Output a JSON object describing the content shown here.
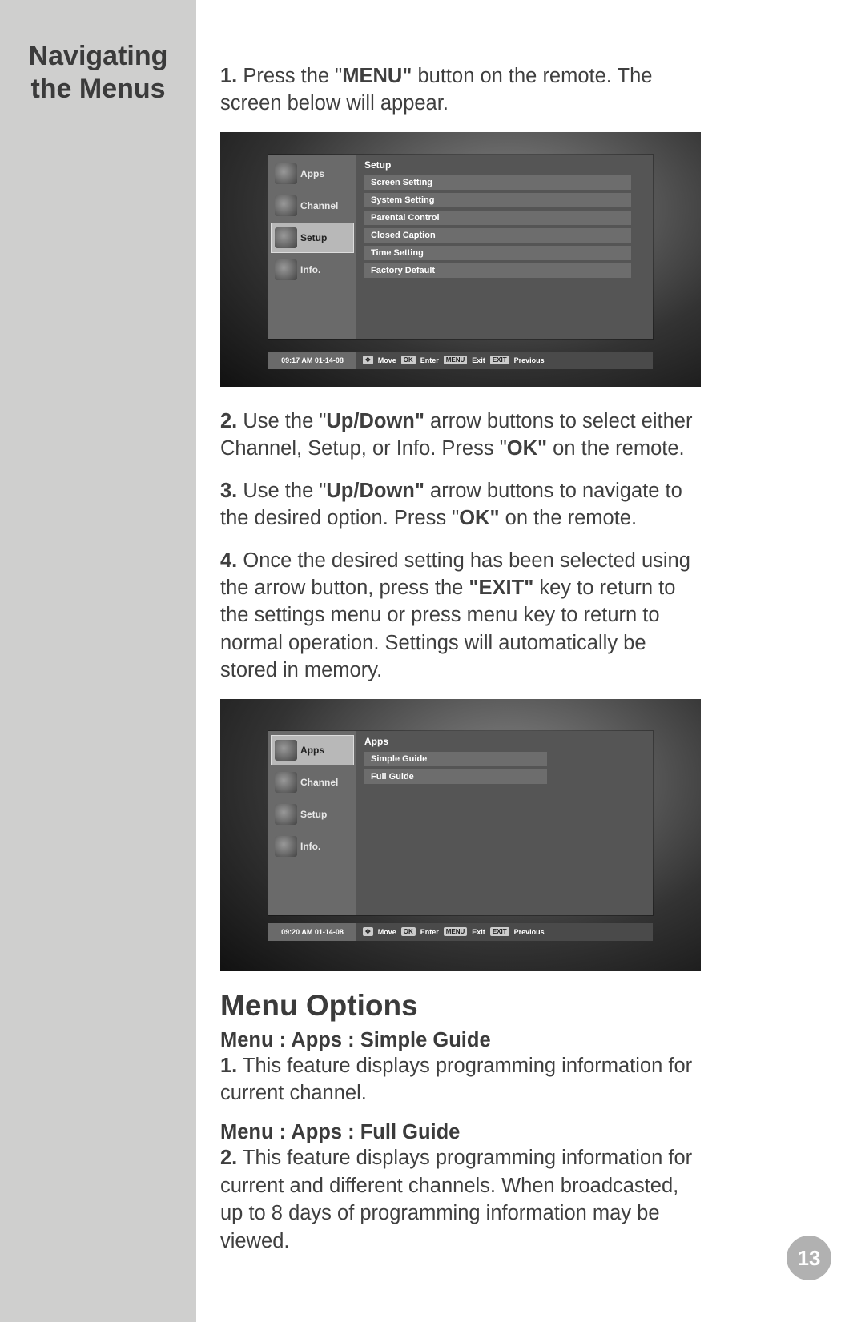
{
  "sidebar": {
    "title_line1": "Navigating",
    "title_line2": "the Menus"
  },
  "steps": {
    "s1_pre": "1.",
    "s1_a": " Press the \"",
    "s1_bold": "MENU\"",
    "s1_b": " button on the remote. The screen below will appear.",
    "s2_pre": "2.",
    "s2_a": " Use the \"",
    "s2_bold1": "Up/Down\"",
    "s2_b": " arrow buttons to select either Channel, Setup, or Info. Press \"",
    "s2_bold2": "OK\"",
    "s2_c": " on the remote.",
    "s3_pre": "3.",
    "s3_a": " Use the \"",
    "s3_bold1": "Up/Down\"",
    "s3_b": " arrow buttons to navigate to the desired option. Press \"",
    "s3_bold2": "OK\"",
    "s3_c": " on the remote.",
    "s4_pre": "4.",
    "s4_a": " Once the desired setting has been selected using the arrow button, press the ",
    "s4_bold": "\"EXIT\"",
    "s4_b": " key to return to the settings menu or press menu key to return to normal operation. Settings will automatically be stored in memory."
  },
  "shot1": {
    "tabs": [
      "Apps",
      "Channel",
      "Setup",
      "Info."
    ],
    "selected_index": 2,
    "panel_title": "Setup",
    "rows": [
      "Screen Setting",
      "System Setting",
      "Parental Control",
      "Closed Caption",
      "Time Setting",
      "Factory Default"
    ],
    "timestamp": "09:17 AM 01-14-08",
    "hints": {
      "move": "Move",
      "ok": "OK",
      "enter": "Enter",
      "menu": "MENU",
      "exit_lbl": "Exit",
      "exit_btn": "EXIT",
      "prev": "Previous"
    }
  },
  "shot2": {
    "tabs": [
      "Apps",
      "Channel",
      "Setup",
      "Info."
    ],
    "selected_index": 0,
    "panel_title": "Apps",
    "rows": [
      "Simple Guide",
      "Full Guide"
    ],
    "timestamp": "09:20 AM 01-14-08",
    "hints": {
      "move": "Move",
      "ok": "OK",
      "enter": "Enter",
      "menu": "MENU",
      "exit_lbl": "Exit",
      "exit_btn": "EXIT",
      "prev": "Previous"
    }
  },
  "menu_options": {
    "heading": "Menu Options",
    "sub1": "Menu  :  Apps  :  Simple Guide",
    "p1_pre": "1.",
    "p1": " This feature  displays programming information for current channel.",
    "sub2": "Menu  :  Apps  :  Full Guide",
    "p2_pre": "2.",
    "p2": " This feature displays programming information for current and different channels. When broadcasted, up to 8 days of programming information may be viewed."
  },
  "page_number": "13"
}
